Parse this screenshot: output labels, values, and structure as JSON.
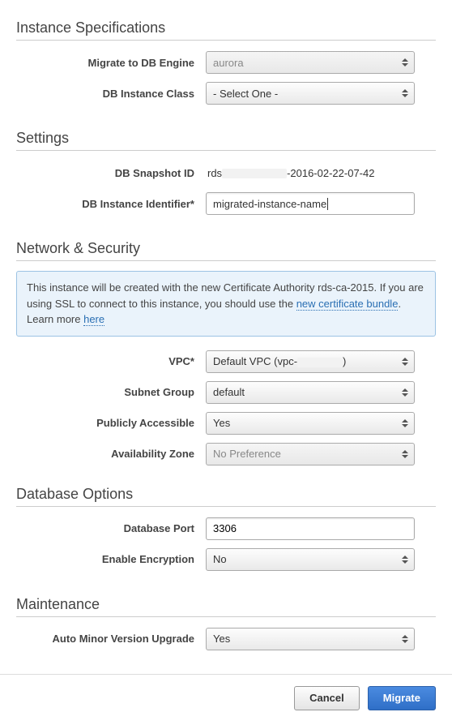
{
  "instance_specs": {
    "title": "Instance Specifications",
    "engine_label": "Migrate to DB Engine",
    "engine_value": "aurora",
    "class_label": "DB Instance Class",
    "class_value": "- Select One -"
  },
  "settings": {
    "title": "Settings",
    "snapshot_label": "DB Snapshot ID",
    "snapshot_prefix": "rds",
    "snapshot_suffix": "-2016-02-22-07-42",
    "identifier_label": "DB Instance Identifier*",
    "identifier_value": "migrated-instance-name"
  },
  "network": {
    "title": "Network & Security",
    "notice_part1": "This instance will be created with the new Certificate Authority rds-ca-2015. If you are using SSL to connect to this instance, you should use the ",
    "notice_link1": "new certificate bundle",
    "notice_part2": ". Learn more ",
    "notice_link2": "here",
    "vpc_label": "VPC*",
    "vpc_prefix": "Default VPC (vpc-",
    "vpc_suffix": ")",
    "subnet_label": "Subnet Group",
    "subnet_value": "default",
    "public_label": "Publicly Accessible",
    "public_value": "Yes",
    "az_label": "Availability Zone",
    "az_value": "No Preference"
  },
  "db_options": {
    "title": "Database Options",
    "port_label": "Database Port",
    "port_value": "3306",
    "encrypt_label": "Enable Encryption",
    "encrypt_value": "No"
  },
  "maintenance": {
    "title": "Maintenance",
    "auto_upgrade_label": "Auto Minor Version Upgrade",
    "auto_upgrade_value": "Yes"
  },
  "footer": {
    "cancel": "Cancel",
    "migrate": "Migrate"
  }
}
